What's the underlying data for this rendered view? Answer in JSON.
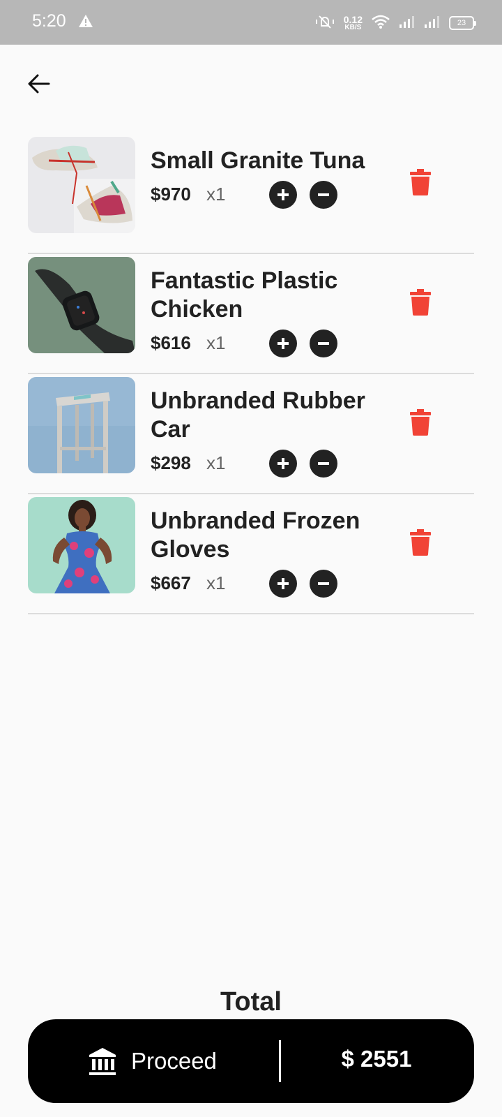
{
  "status_bar": {
    "time": "5:20",
    "net_speed_value": "0.12",
    "net_speed_unit": "KB/S",
    "battery": "23"
  },
  "cart": {
    "items": [
      {
        "name": "Small Granite Tuna",
        "price": "$970",
        "qty": "x1",
        "image": "sneakers-photo"
      },
      {
        "name": "Fantastic Plastic Chicken",
        "price": "$616",
        "qty": "x1",
        "image": "smartwatch-photo"
      },
      {
        "name": "Unbranded Rubber Car",
        "price": "$298",
        "qty": "x1",
        "image": "stool-photo"
      },
      {
        "name": "Unbranded Frozen Gloves",
        "price": "$667",
        "qty": "x1",
        "image": "dress-model-photo"
      }
    ]
  },
  "footer": {
    "total_label": "Total",
    "proceed_label": "Proceed",
    "total_amount": "$ 2551"
  },
  "colors": {
    "delete": "#f14336",
    "bar": "#000000",
    "status_bar": "#b7b7b7"
  }
}
